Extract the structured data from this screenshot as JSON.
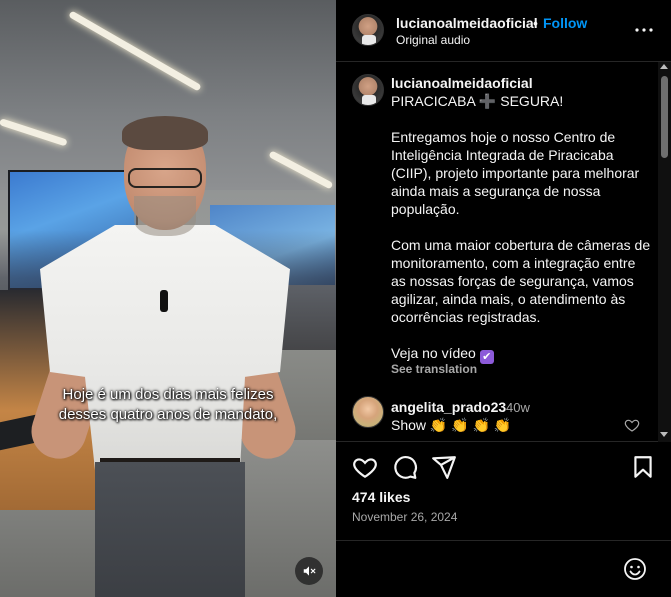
{
  "video": {
    "subtitle_line1": "Hoje é um dos dias mais felizes",
    "subtitle_line2": "desses quatro anos de mandato,",
    "mute_icon": "speaker-muted-icon"
  },
  "header": {
    "username": "lucianoalmeidaoficial",
    "separator": "•",
    "follow_label": "Follow",
    "audio_label": "Original audio",
    "more_icon": "more-horizontal-icon"
  },
  "caption": {
    "username": "lucianoalmeidaoficial",
    "title_part1": "PIRACICABA",
    "title_plus": "➕",
    "title_part2": "SEGURA!",
    "paragraph1": "Entregamos hoje o nosso Centro de Inteligência Integrada de Piracicaba (CIIP), projeto importante para melhorar ainda mais a segurança de nossa população.",
    "paragraph2": "Com uma maior cobertura de câmeras de monitoramento, com a integração entre as nossas forças de segurança, vamos agilizar, ainda mais, o atendimento às ocorrências registradas.",
    "paragraph3": "Veja no vídeo",
    "check_emoji": "✔",
    "see_translation": "See translation"
  },
  "comment": {
    "username": "angelita_prado23",
    "time": "40w",
    "text": "Show",
    "emojis": "👏 👏 👏 👏"
  },
  "post": {
    "likes": "474 likes",
    "date": "November 26, 2024"
  },
  "icons": {
    "like": "heart-icon",
    "comment": "comment-icon",
    "share": "share-icon",
    "save": "bookmark-icon",
    "emoji": "emoji-icon"
  },
  "colors": {
    "accent": "#0095f6",
    "background": "#000000",
    "text": "#f5f5f5",
    "muted": "#a8a8a8"
  }
}
